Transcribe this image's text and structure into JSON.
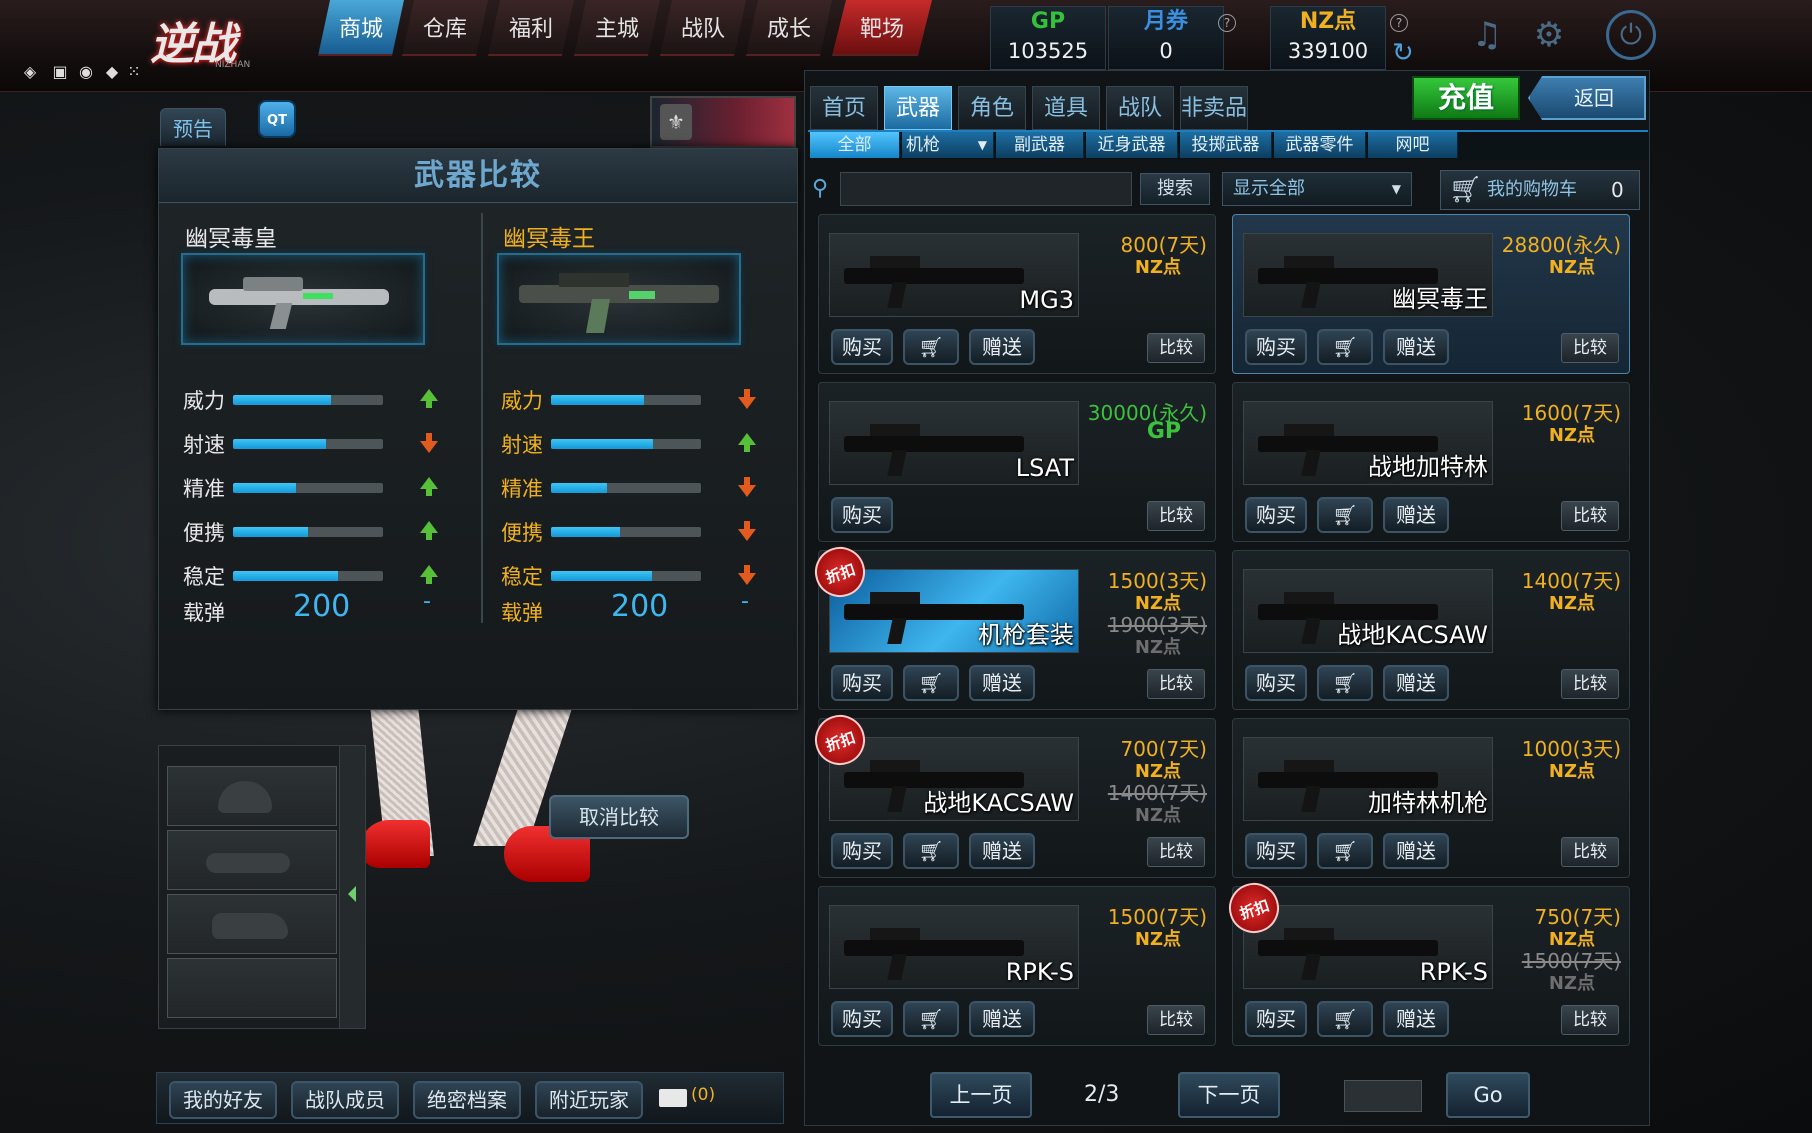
{
  "nav": {
    "logo": "逆战",
    "logo_sub": "NIZHAN",
    "items": [
      "商城",
      "仓库",
      "福利",
      "主城",
      "战队",
      "成长",
      "靶场"
    ]
  },
  "currency": [
    {
      "label": "GP",
      "value": "103525",
      "color": "#34c23a"
    },
    {
      "label": "月券",
      "value": "0",
      "color": "#3a8fe0"
    },
    {
      "label": "NZ点",
      "value": "339100",
      "color": "#f0b020"
    }
  ],
  "left": {
    "tab": "预告",
    "qt": "QT"
  },
  "compare": {
    "title": "武器比较",
    "cancel_label": "取消比较",
    "weapons": [
      {
        "name": "幽冥毒皇",
        "name_color": "#e8e8e8",
        "label_color": "#e8e8e8",
        "stats": [
          {
            "label": "威力",
            "value": 0.65,
            "dir": "up"
          },
          {
            "label": "射速",
            "value": 0.62,
            "dir": "down"
          },
          {
            "label": "精准",
            "value": 0.42,
            "dir": "up"
          },
          {
            "label": "便携",
            "value": 0.5,
            "dir": "up"
          },
          {
            "label": "稳定",
            "value": 0.7,
            "dir": "up"
          }
        ],
        "ammo_label": "载弹",
        "ammo": "200",
        "ammo_change": "-"
      },
      {
        "name": "幽冥毒王",
        "name_color": "#f0b020",
        "label_color": "#f0b020",
        "stats": [
          {
            "label": "威力",
            "value": 0.62,
            "dir": "down"
          },
          {
            "label": "射速",
            "value": 0.68,
            "dir": "up"
          },
          {
            "label": "精准",
            "value": 0.37,
            "dir": "down"
          },
          {
            "label": "便携",
            "value": 0.46,
            "dir": "down"
          },
          {
            "label": "稳定",
            "value": 0.67,
            "dir": "down"
          }
        ],
        "ammo_label": "载弹",
        "ammo": "200",
        "ammo_change": "-"
      }
    ]
  },
  "bottombar": {
    "items": [
      "我的好友",
      "战队成员",
      "绝密档案",
      "附近玩家"
    ],
    "mail_count": "(0)"
  },
  "shop": {
    "topup": "充值",
    "back": "返回",
    "tabs": [
      "首页",
      "武器",
      "角色",
      "道具",
      "战队",
      "非卖品"
    ],
    "subtabs": [
      "全部",
      "机枪",
      "副武器",
      "近身武器",
      "投掷武器",
      "武器零件",
      "网吧"
    ],
    "search_label": "搜索",
    "filter": "显示全部",
    "cart_label": "我的购物车",
    "cart_count": "0",
    "buy": "购买",
    "gift": "赠送",
    "compare": "比较",
    "discount": "折扣",
    "items": [
      {
        "name": "MG3",
        "price": "800(7天)",
        "currency": "NZ点",
        "gp": false,
        "gift": true,
        "discount": false,
        "old_price": "",
        "old_currency": "",
        "selected": false
      },
      {
        "name": "幽冥毒王",
        "price": "28800(永久)",
        "currency": "NZ点",
        "gp": false,
        "gift": true,
        "discount": false,
        "old_price": "",
        "old_currency": "",
        "selected": true
      },
      {
        "name": "LSAT",
        "price": "30000(永久)",
        "currency": "GP",
        "gp": true,
        "gift": false,
        "discount": false,
        "old_price": "",
        "old_currency": "",
        "selected": false
      },
      {
        "name": "战地加特林",
        "price": "1600(7天)",
        "currency": "NZ点",
        "gp": false,
        "gift": true,
        "discount": false,
        "old_price": "",
        "old_currency": "",
        "selected": false
      },
      {
        "name": "机枪套装",
        "price": "1500(3天)",
        "currency": "NZ点",
        "gp": false,
        "gift": true,
        "discount": true,
        "old_price": "1900(3天)",
        "old_currency": "NZ点",
        "selected": false,
        "promo": true
      },
      {
        "name": "战地KACSAW",
        "price": "1400(7天)",
        "currency": "NZ点",
        "gp": false,
        "gift": true,
        "discount": false,
        "old_price": "",
        "old_currency": "",
        "selected": false
      },
      {
        "name": "战地KACSAW",
        "price": "700(7天)",
        "currency": "NZ点",
        "gp": false,
        "gift": true,
        "discount": true,
        "old_price": "1400(7天)",
        "old_currency": "NZ点",
        "selected": false
      },
      {
        "name": "加特林机枪",
        "price": "1000(3天)",
        "currency": "NZ点",
        "gp": false,
        "gift": true,
        "discount": false,
        "old_price": "",
        "old_currency": "",
        "selected": false
      },
      {
        "name": "RPK-S",
        "price": "1500(7天)",
        "currency": "NZ点",
        "gp": false,
        "gift": true,
        "discount": false,
        "old_price": "",
        "old_currency": "",
        "selected": false
      },
      {
        "name": "RPK-S",
        "price": "750(7天)",
        "currency": "NZ点",
        "gp": false,
        "gift": true,
        "discount": true,
        "old_price": "1500(7天)",
        "old_currency": "NZ点",
        "selected": false
      }
    ],
    "pagination": {
      "prev": "上一页",
      "page": "2/3",
      "next": "下一页",
      "go": "Go"
    }
  }
}
